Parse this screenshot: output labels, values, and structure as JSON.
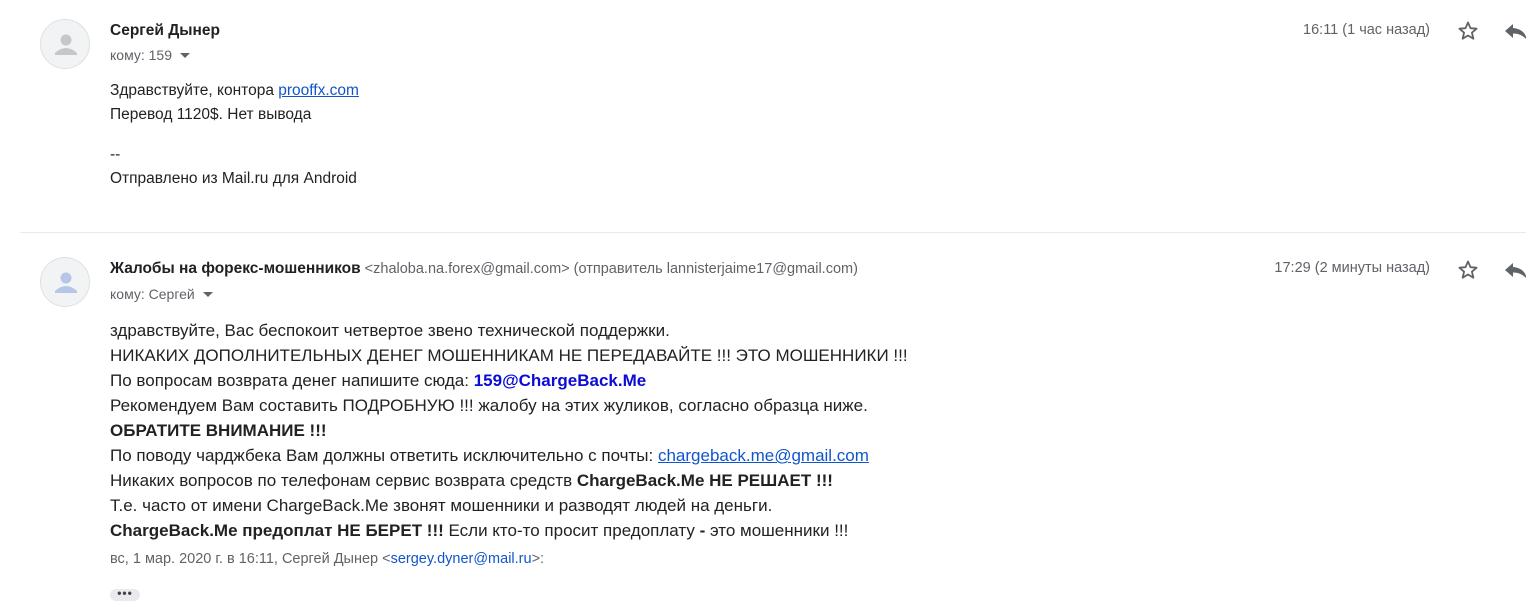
{
  "message1": {
    "sender_name": "Сергей Дынер",
    "to_label": "кому: 159",
    "time": "16:11 (1 час назад)",
    "lines": {
      "l1_prefix": "Здравствуйте, контора ",
      "l1_link": "prooffx.com",
      "l2": "Перевод 1120$. Нет вывода",
      "l3": "--",
      "l4": "Отправлено из Mail.ru для Android"
    }
  },
  "message2": {
    "sender_name": "Жалобы на форекс-мошенников",
    "sender_email": "<zhaloba.na.forex@gmail.com>",
    "sender_via": "(отправитель lannisterjaime17@gmail.com)",
    "to_label": "кому: Сергей",
    "time": "17:29 (2 минуты назад)",
    "lines": {
      "l1": "здравствуйте, Вас беспокоит четвертое звено технической поддержки.",
      "l2": "НИКАКИХ ДОПОЛНИТЕЛЬНЫХ ДЕНЕГ МОШЕННИКАМ НЕ ПЕРЕДАВАЙТЕ !!! ЭТО МОШЕННИКИ !!!",
      "l3_prefix": "По вопросам возврата денег напишите сюда: ",
      "l3_email": "159@ChargeBack.Me",
      "l4": "Рекомендуем Вам составить ПОДРОБНУЮ !!! жалобу на этих жуликов, согласно образца ниже.",
      "l5": "ОБРАТИТЕ ВНИМАНИЕ !!!",
      "l6_prefix": "По поводу чарджбека Вам должны ответить исключительно с почты: ",
      "l6_link": "chargeback.me@gmail.com",
      "l7_prefix": "Никаких вопросов по телефонам сервис возврата средств ",
      "l7_bold": "ChargeBack.Me НЕ РЕШАЕТ !!!",
      "l8": "Т.е. часто от имени ChargeBack.Me звонят мошенники и разводят людей на деньги.",
      "l9_bold1": "ChargeBack.Me предоплат НЕ БЕРЕТ !!!",
      "l9_mid": " Если кто-то просит предоплату ",
      "l9_dash": "-",
      "l9_end": " это мошенники !!!"
    },
    "quote": {
      "prefix": "вс, 1 мар. 2020 г. в 16:11, Сергей Дынер <",
      "email": "sergey.dyner@mail.ru",
      "suffix": ">:"
    },
    "expand_dots": "•••"
  },
  "icons": {
    "avatar": "person-icon",
    "star": "star-icon",
    "reply": "reply-icon",
    "caret": "chevron-down-icon"
  },
  "colors": {
    "link": "#1155cc",
    "meta": "#5f6368",
    "highlight_email": "#0b0bd6"
  }
}
